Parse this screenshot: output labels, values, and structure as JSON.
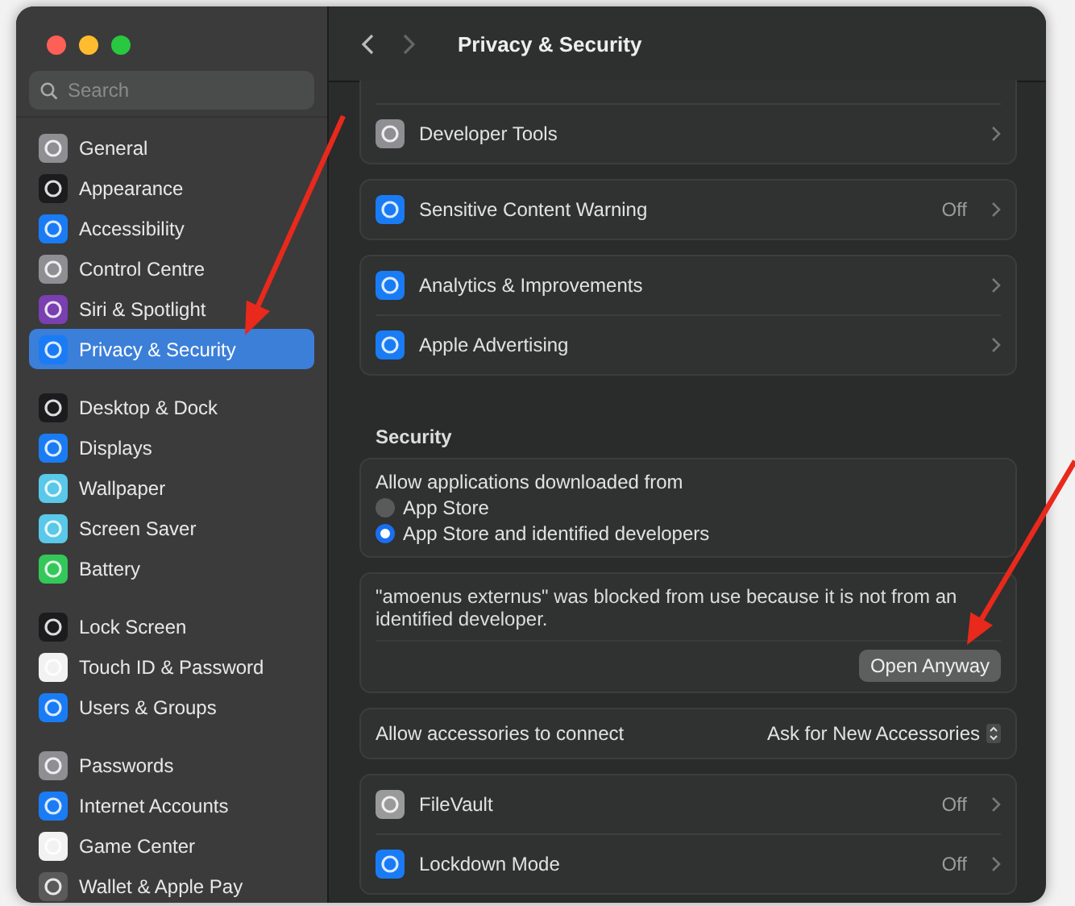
{
  "window": {
    "title": "Privacy & Security"
  },
  "sidebar": {
    "search": {
      "placeholder": "Search"
    },
    "groups": [
      [
        {
          "label": "General",
          "color": "#8e8e93",
          "selected": false
        },
        {
          "label": "Appearance",
          "color": "#1c1c1e",
          "selected": false
        },
        {
          "label": "Accessibility",
          "color": "#1a7cf5",
          "selected": false
        },
        {
          "label": "Control Centre",
          "color": "#8e8e93",
          "selected": false
        },
        {
          "label": "Siri & Spotlight",
          "color": "#7a3fb0",
          "selected": false
        },
        {
          "label": "Privacy & Security",
          "color": "#1a7cf5",
          "selected": true
        }
      ],
      [
        {
          "label": "Desktop & Dock",
          "color": "#1c1c1e",
          "selected": false
        },
        {
          "label": "Displays",
          "color": "#1a7cf5",
          "selected": false
        },
        {
          "label": "Wallpaper",
          "color": "#5ac8e8",
          "selected": false
        },
        {
          "label": "Screen Saver",
          "color": "#5ac8e8",
          "selected": false
        },
        {
          "label": "Battery",
          "color": "#34c759",
          "selected": false
        }
      ],
      [
        {
          "label": "Lock Screen",
          "color": "#1c1c1e",
          "selected": false
        },
        {
          "label": "Touch ID & Password",
          "color": "#f2f2f2",
          "selected": false
        },
        {
          "label": "Users & Groups",
          "color": "#1a7cf5",
          "selected": false
        }
      ],
      [
        {
          "label": "Passwords",
          "color": "#8e8e93",
          "selected": false
        },
        {
          "label": "Internet Accounts",
          "color": "#1a7cf5",
          "selected": false
        },
        {
          "label": "Game Center",
          "color": "#f2f2f2",
          "selected": false
        },
        {
          "label": "Wallet & Apple Pay",
          "color": "#5a5a5a",
          "selected": false
        }
      ]
    ]
  },
  "main": {
    "blocks": [
      {
        "kind": "list",
        "cut_top": true,
        "rows": [
          {
            "label": "Developer Tools",
            "color": "#8e8e93"
          }
        ]
      },
      {
        "kind": "list",
        "rows": [
          {
            "label": "Sensitive Content Warning",
            "value": "Off",
            "color": "#1a7cf5"
          }
        ]
      },
      {
        "kind": "list",
        "rows": [
          {
            "label": "Analytics & Improvements",
            "color": "#1a7cf5"
          },
          {
            "label": "Apple Advertising",
            "color": "#1a7cf5"
          }
        ]
      },
      {
        "kind": "header",
        "title": "Security"
      },
      {
        "kind": "radio",
        "title": "Allow applications downloaded from",
        "options": [
          {
            "label": "App Store",
            "selected": false
          },
          {
            "label": "App Store and identified developers",
            "selected": true
          }
        ]
      },
      {
        "kind": "notice",
        "text": "\"amoenus externus\" was blocked from use because it is not from an identified developer.",
        "button": "Open Anyway"
      },
      {
        "kind": "popup",
        "label": "Allow accessories to connect",
        "value": "Ask for New Accessories"
      },
      {
        "kind": "list",
        "rows": [
          {
            "label": "FileVault",
            "value": "Off",
            "color": "#9a9a9a"
          },
          {
            "label": "Lockdown Mode",
            "value": "Off",
            "color": "#1a7cf5"
          }
        ]
      }
    ]
  }
}
